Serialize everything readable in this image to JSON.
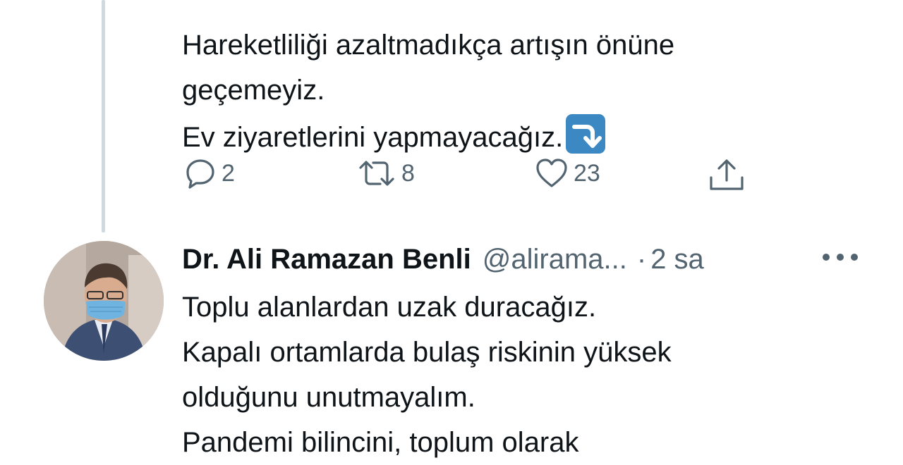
{
  "thread": {
    "tweet1": {
      "lines": [
        "Hareketliliği azaltmadıkça artışın önüne",
        "geçemeyiz.",
        "Ev ziyaretlerini yapmayacağız."
      ],
      "emoji": "arrow-right-hook-down-emoji",
      "actions": {
        "reply_count": "2",
        "retweet_count": "8",
        "like_count": "23"
      }
    },
    "tweet2": {
      "author_name": "Dr. Ali Ramazan Benli",
      "handle": "@alirama...",
      "separator": "·",
      "time": "2 sa",
      "lines": [
        "Toplu alanlardan uzak duracağız.",
        "Kapalı ortamlarda bulaş riskinin yüksek",
        "olduğunu unutmayalım.",
        "Pandemi bilincini, toplum olarak"
      ]
    }
  },
  "colors": {
    "text": "#0f1419",
    "secondary": "#536471",
    "thread_line": "#cfd9de",
    "emoji_blue": "#3b88c3"
  }
}
